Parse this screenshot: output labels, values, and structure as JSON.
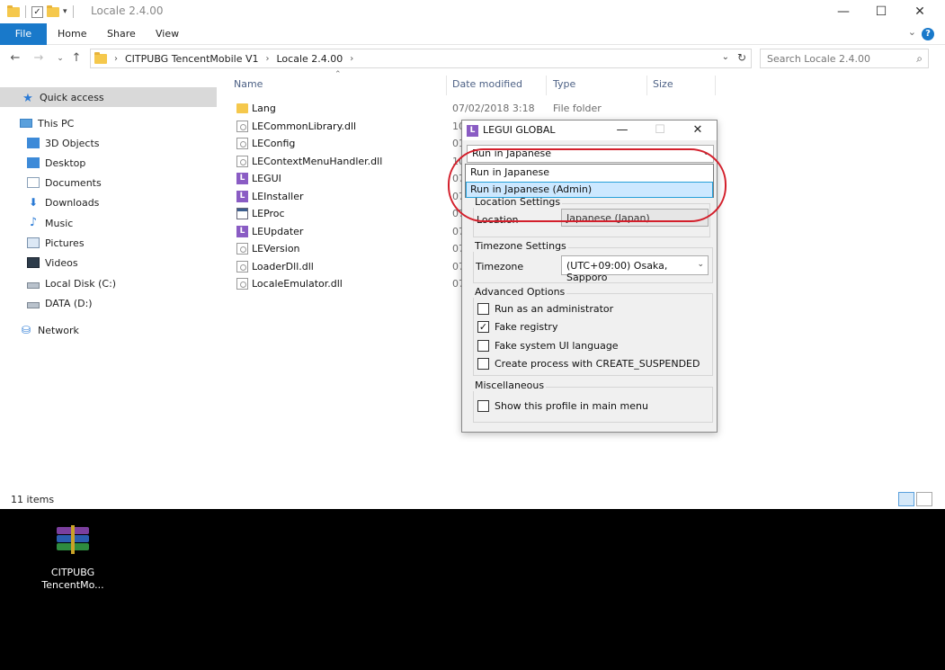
{
  "explorer": {
    "title": "Locale 2.4.00",
    "menu": [
      "File",
      "Home",
      "Share",
      "View"
    ],
    "breadcrumb": [
      "CITPUBG TencentMobile V1",
      "Locale 2.4.00"
    ],
    "search_placeholder": "Search Locale 2.4.00",
    "columns": [
      "Name",
      "Date modified",
      "Type",
      "Size"
    ],
    "nav": {
      "quick_access": "Quick access",
      "this_pc": "This PC",
      "items": [
        "3D Objects",
        "Desktop",
        "Documents",
        "Downloads",
        "Music",
        "Pictures",
        "Videos",
        "Local Disk (C:)",
        "DATA (D:)"
      ],
      "network": "Network"
    },
    "files": [
      {
        "name": "Lang",
        "date": "07/02/2018 3:18",
        "type": "File folder",
        "icon": "folder-icon"
      },
      {
        "name": "LECommonLibrary.dll",
        "date": "10",
        "type": "",
        "icon": "dll-icon"
      },
      {
        "name": "LEConfig",
        "date": "01",
        "type": "",
        "icon": "dll-icon"
      },
      {
        "name": "LEContextMenuHandler.dll",
        "date": "10",
        "type": "",
        "icon": "dll-icon"
      },
      {
        "name": "LEGUI",
        "date": "07",
        "type": "",
        "icon": "app-icon"
      },
      {
        "name": "LEInstaller",
        "date": "07",
        "type": "",
        "icon": "app-icon"
      },
      {
        "name": "LEProc",
        "date": "07",
        "type": "",
        "icon": "exe-icon"
      },
      {
        "name": "LEUpdater",
        "date": "07",
        "type": "",
        "icon": "app-icon"
      },
      {
        "name": "LEVersion",
        "date": "07",
        "type": "",
        "icon": "dll-icon"
      },
      {
        "name": "LoaderDll.dll",
        "date": "07",
        "type": "",
        "icon": "dll-icon"
      },
      {
        "name": "LocaleEmulator.dll",
        "date": "07",
        "type": "",
        "icon": "dll-icon"
      }
    ],
    "status": "11 items"
  },
  "dialog": {
    "title": "LEGUI GLOBAL",
    "logo_letter": "L",
    "profile_value": "Run in Japanese",
    "dropdown_options": [
      "Run in Japanese",
      "Run in Japanese (Admin)"
    ],
    "dropdown_highlighted": 1,
    "location_group": "Location Settings",
    "location_label": "Location",
    "location_value": "Japanese (Japan)",
    "timezone_group": "Timezone Settings",
    "timezone_label": "Timezone",
    "timezone_value": "(UTC+09:00) Osaka, Sapporo",
    "advanced_group": "Advanced Options",
    "advanced": [
      {
        "label": "Run as an administrator",
        "checked": false
      },
      {
        "label": "Fake registry",
        "checked": true
      },
      {
        "label": "Fake system UI language",
        "checked": false
      },
      {
        "label": "Create process with CREATE_SUSPENDED",
        "checked": false
      }
    ],
    "misc_group": "Miscellaneous",
    "misc": [
      {
        "label": "Show this profile in main menu",
        "checked": false
      }
    ]
  },
  "desktop_icon": {
    "label_line1": "CITPUBG",
    "label_line2": "TencentMo..."
  },
  "colors": {
    "accent": "#1979ca",
    "highlight": "#cce8ff",
    "annotation": "#d31f2b"
  }
}
